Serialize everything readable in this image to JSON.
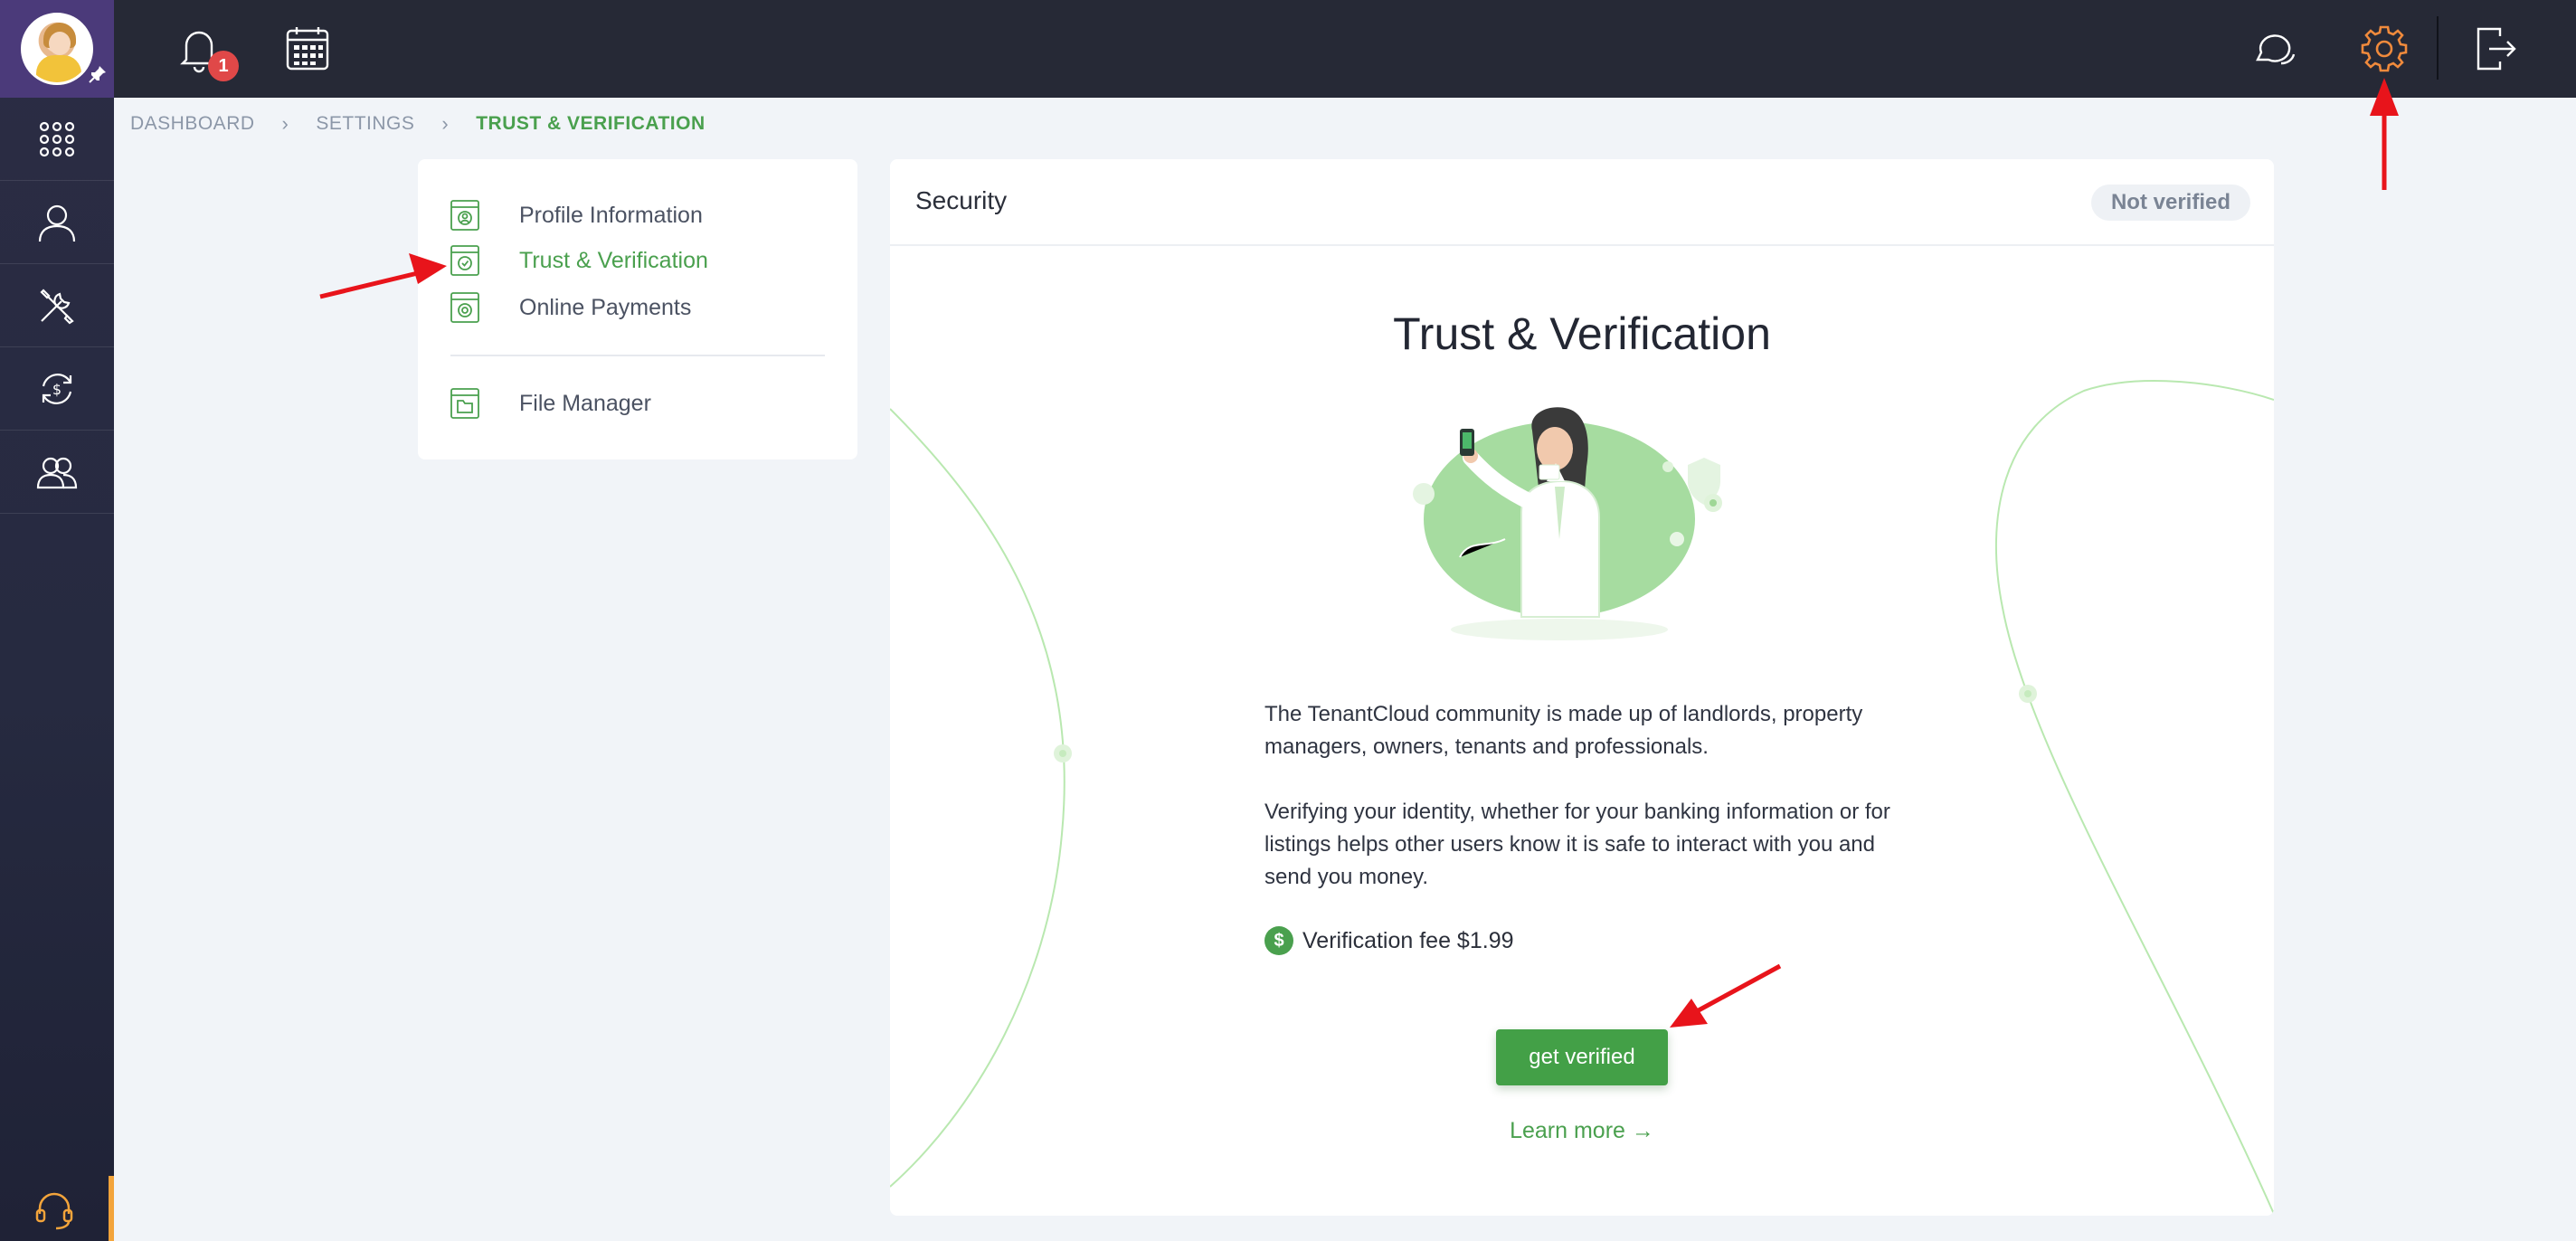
{
  "sidebar": {
    "items": [
      {
        "name": "apps-grid-icon"
      },
      {
        "name": "user-icon"
      },
      {
        "name": "tools-icon"
      },
      {
        "name": "transactions-icon"
      },
      {
        "name": "contacts-icon"
      }
    ]
  },
  "topbar": {
    "notifications_count": "1"
  },
  "breadcrumb": {
    "items": [
      "DASHBOARD",
      "SETTINGS",
      "TRUST & VERIFICATION"
    ],
    "separator": "›"
  },
  "settings_menu": {
    "items": [
      {
        "label": "Profile Information",
        "icon": "profile-icon"
      },
      {
        "label": "Trust & Verification",
        "icon": "shield-check-icon",
        "active": true
      },
      {
        "label": "Online Payments",
        "icon": "payments-icon"
      },
      {
        "label": "File Manager",
        "icon": "folder-icon"
      }
    ]
  },
  "panel": {
    "title": "Security",
    "status": "Not verified",
    "hero_title": "Trust & Verification",
    "paragraph_1": "The TenantCloud community is made up of landlords, property managers, owners, tenants and professionals.",
    "paragraph_2": "Verifying your identity, whether for your banking information or for listings helps other users know it is safe to interact with you and send you money.",
    "fee_label": "Verification fee $1.99",
    "fee_icon_glyph": "$",
    "button_label": "get verified",
    "learn_more": "Learn more →"
  },
  "colors": {
    "accent_green": "#43a047",
    "sidebar_bg": "#262a40",
    "topbar_bg": "#262936",
    "badge_red": "#e04848",
    "settings_icon_orange": "#f08a3c",
    "annotation_red": "#e8141b"
  }
}
